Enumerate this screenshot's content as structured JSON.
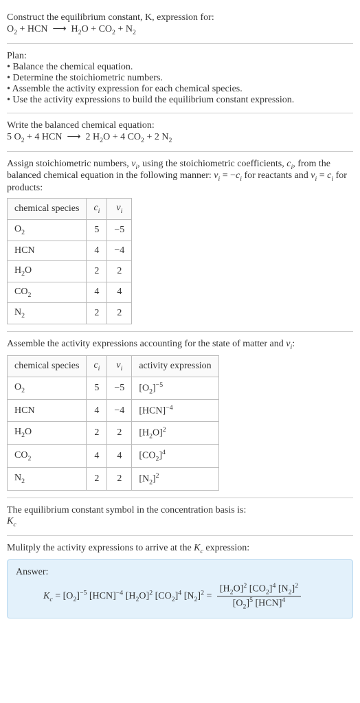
{
  "header": {
    "prompt_line1": "Construct the equilibrium constant, K, expression for:",
    "equation_unbalanced_html": "O<span class='sub'>2</span> + HCN &nbsp;⟶&nbsp; H<span class='sub'>2</span>O + CO<span class='sub'>2</span> + N<span class='sub'>2</span>"
  },
  "plan": {
    "title": "Plan:",
    "items": [
      "Balance the chemical equation.",
      "Determine the stoichiometric numbers.",
      "Assemble the activity expression for each chemical species.",
      "Use the activity expressions to build the equilibrium constant expression."
    ]
  },
  "balanced": {
    "title": "Write the balanced chemical equation:",
    "equation_html": "5 O<span class='sub'>2</span> + 4 HCN &nbsp;⟶&nbsp; 2 H<span class='sub'>2</span>O + 4 CO<span class='sub'>2</span> + 2 N<span class='sub'>2</span>"
  },
  "stoich_intro_html": "Assign stoichiometric numbers, <span class='italic'>ν<span class='sub'>i</span></span>, using the stoichiometric coefficients, <span class='italic'>c<span class='sub'>i</span></span>, from the balanced chemical equation in the following manner: <span class='italic'>ν<span class='sub'>i</span></span> = −<span class='italic'>c<span class='sub'>i</span></span> for reactants and <span class='italic'>ν<span class='sub'>i</span></span> = <span class='italic'>c<span class='sub'>i</span></span> for products:",
  "table1": {
    "headers": {
      "species": "chemical species",
      "ci_html": "<span class='italic'>c<span class='sub'>i</span></span>",
      "vi_html": "<span class='italic'>ν<span class='sub'>i</span></span>"
    },
    "rows": [
      {
        "species_html": "O<span class='sub'>2</span>",
        "ci": "5",
        "vi": "−5"
      },
      {
        "species_html": "HCN",
        "ci": "4",
        "vi": "−4"
      },
      {
        "species_html": "H<span class='sub'>2</span>O",
        "ci": "2",
        "vi": "2"
      },
      {
        "species_html": "CO<span class='sub'>2</span>",
        "ci": "4",
        "vi": "4"
      },
      {
        "species_html": "N<span class='sub'>2</span>",
        "ci": "2",
        "vi": "2"
      }
    ]
  },
  "activity_intro_html": "Assemble the activity expressions accounting for the state of matter and <span class='italic'>ν<span class='sub'>i</span></span>:",
  "table2": {
    "headers": {
      "species": "chemical species",
      "ci_html": "<span class='italic'>c<span class='sub'>i</span></span>",
      "vi_html": "<span class='italic'>ν<span class='sub'>i</span></span>",
      "act": "activity expression"
    },
    "rows": [
      {
        "species_html": "O<span class='sub'>2</span>",
        "ci": "5",
        "vi": "−5",
        "act_html": "[O<span class='sub'>2</span>]<span class='sup'>−5</span>"
      },
      {
        "species_html": "HCN",
        "ci": "4",
        "vi": "−4",
        "act_html": "[HCN]<span class='sup'>−4</span>"
      },
      {
        "species_html": "H<span class='sub'>2</span>O",
        "ci": "2",
        "vi": "2",
        "act_html": "[H<span class='sub'>2</span>O]<span class='sup'>2</span>"
      },
      {
        "species_html": "CO<span class='sub'>2</span>",
        "ci": "4",
        "vi": "4",
        "act_html": "[CO<span class='sub'>2</span>]<span class='sup'>4</span>"
      },
      {
        "species_html": "N<span class='sub'>2</span>",
        "ci": "2",
        "vi": "2",
        "act_html": "[N<span class='sub'>2</span>]<span class='sup'>2</span>"
      }
    ]
  },
  "kc_symbol": {
    "line1": "The equilibrium constant symbol in the concentration basis is:",
    "line2_html": "<span class='italic'>K<span class='sub'>c</span></span>"
  },
  "final": {
    "intro_html": "Mulitply the activity expressions to arrive at the <span class='italic'>K<span class='sub'>c</span></span> expression:",
    "answer_label": "Answer:",
    "lhs_html": "<span class='italic'>K<span class='sub'>c</span></span> = [O<span class='sub'>2</span>]<span class='sup'>−5</span> [HCN]<span class='sup'>−4</span> [H<span class='sub'>2</span>O]<span class='sup'>2</span> [CO<span class='sub'>2</span>]<span class='sup'>4</span> [N<span class='sub'>2</span>]<span class='sup'>2</span> = ",
    "frac_num_html": "[H<span class='sub'>2</span>O]<span class='sup'>2</span> [CO<span class='sub'>2</span>]<span class='sup'>4</span> [N<span class='sub'>2</span>]<span class='sup'>2</span>",
    "frac_den_html": "[O<span class='sub'>2</span>]<span class='sup'>5</span> [HCN]<span class='sup'>4</span>"
  }
}
